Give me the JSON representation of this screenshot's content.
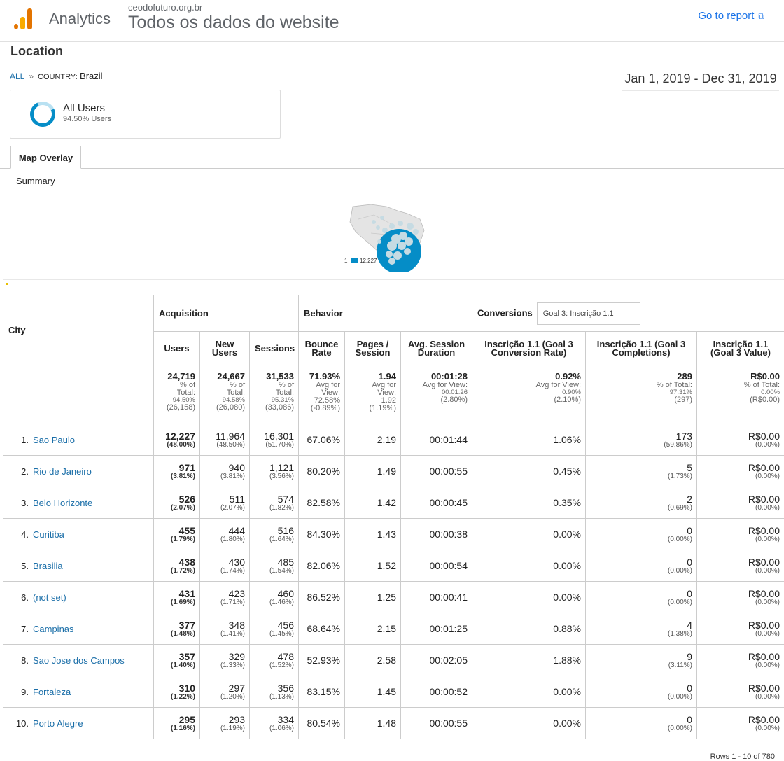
{
  "header": {
    "app_name": "Analytics",
    "account": "ceodofuturo.org.br",
    "view": "Todos os dados do website",
    "go_to_report": "Go to report"
  },
  "page": {
    "title": "Location",
    "breadcrumb_all": "ALL",
    "breadcrumb_sep": "»",
    "breadcrumb_dim": "COUNTRY:",
    "breadcrumb_value": "Brazil",
    "date_range": "Jan 1, 2019 - Dec 31, 2019"
  },
  "segment": {
    "name": "All Users",
    "pct": "94.50% Users"
  },
  "tabs": {
    "active": "Map Overlay",
    "sub": "Summary"
  },
  "map": {
    "legend_min": "1",
    "legend_max": "12,227",
    "color": "#058dc7"
  },
  "table": {
    "groups": {
      "city": "City",
      "acquisition": "Acquisition",
      "behavior": "Behavior",
      "conversions": "Conversions",
      "goal_select": "Goal 3: Inscrição 1.1"
    },
    "columns": {
      "users": "Users",
      "new_users": "New Users",
      "sessions": "Sessions",
      "bounce": "Bounce Rate",
      "pages": "Pages / Session",
      "duration": "Avg. Session Duration",
      "conv_rate": "Inscrição 1.1 (Goal 3 Conversion Rate)",
      "completions": "Inscrição 1.1 (Goal 3 Completions)",
      "value": "Inscrição 1.1 (Goal 3 Value)"
    },
    "totals": {
      "users": {
        "v": "24,719",
        "l1": "% of",
        "l2": "Total:",
        "l3": "94.50%",
        "l4": "(26,158)"
      },
      "new_users": {
        "v": "24,667",
        "l1": "% of",
        "l2": "Total:",
        "l3": "94.58%",
        "l4": "(26,080)"
      },
      "sessions": {
        "v": "31,533",
        "l1": "% of",
        "l2": "Total:",
        "l3": "95.31%",
        "l4": "(33,086)"
      },
      "bounce": {
        "v": "71.93%",
        "l1": "Avg for",
        "l2": "View:",
        "l3": "72.58%",
        "l4": "(-0.89%)"
      },
      "pages": {
        "v": "1.94",
        "l1": "Avg for",
        "l2": "View:",
        "l3": "1.92",
        "l4": "(1.19%)"
      },
      "duration": {
        "v": "00:01:28",
        "l1": "Avg for View:",
        "l2": "00:01:26",
        "l3": "(2.80%)"
      },
      "conv_rate": {
        "v": "0.92%",
        "l1": "Avg for View:",
        "l2": "0.90%",
        "l3": "(2.10%)"
      },
      "completions": {
        "v": "289",
        "l1": "% of Total:",
        "l2": "97.31%",
        "l3": "(297)"
      },
      "value": {
        "v": "R$0.00",
        "l1": "% of Total:",
        "l2": "0.00%",
        "l3": "(R$0.00)"
      }
    },
    "rows": [
      {
        "n": "1.",
        "city": "Sao Paulo",
        "users": "12,227",
        "users_p": "(48.00%)",
        "new": "11,964",
        "new_p": "(48.50%)",
        "sess": "16,301",
        "sess_p": "(51.70%)",
        "bounce": "67.06%",
        "pages": "2.19",
        "dur": "00:01:44",
        "rate": "1.06%",
        "comp": "173",
        "comp_p": "(59.86%)",
        "val": "R$0.00",
        "val_p": "(0.00%)"
      },
      {
        "n": "2.",
        "city": "Rio de Janeiro",
        "users": "971",
        "users_p": "(3.81%)",
        "new": "940",
        "new_p": "(3.81%)",
        "sess": "1,121",
        "sess_p": "(3.56%)",
        "bounce": "80.20%",
        "pages": "1.49",
        "dur": "00:00:55",
        "rate": "0.45%",
        "comp": "5",
        "comp_p": "(1.73%)",
        "val": "R$0.00",
        "val_p": "(0.00%)"
      },
      {
        "n": "3.",
        "city": "Belo Horizonte",
        "users": "526",
        "users_p": "(2.07%)",
        "new": "511",
        "new_p": "(2.07%)",
        "sess": "574",
        "sess_p": "(1.82%)",
        "bounce": "82.58%",
        "pages": "1.42",
        "dur": "00:00:45",
        "rate": "0.35%",
        "comp": "2",
        "comp_p": "(0.69%)",
        "val": "R$0.00",
        "val_p": "(0.00%)"
      },
      {
        "n": "4.",
        "city": "Curitiba",
        "users": "455",
        "users_p": "(1.79%)",
        "new": "444",
        "new_p": "(1.80%)",
        "sess": "516",
        "sess_p": "(1.64%)",
        "bounce": "84.30%",
        "pages": "1.43",
        "dur": "00:00:38",
        "rate": "0.00%",
        "comp": "0",
        "comp_p": "(0.00%)",
        "val": "R$0.00",
        "val_p": "(0.00%)"
      },
      {
        "n": "5.",
        "city": "Brasilia",
        "users": "438",
        "users_p": "(1.72%)",
        "new": "430",
        "new_p": "(1.74%)",
        "sess": "485",
        "sess_p": "(1.54%)",
        "bounce": "82.06%",
        "pages": "1.52",
        "dur": "00:00:54",
        "rate": "0.00%",
        "comp": "0",
        "comp_p": "(0.00%)",
        "val": "R$0.00",
        "val_p": "(0.00%)"
      },
      {
        "n": "6.",
        "city": "(not set)",
        "users": "431",
        "users_p": "(1.69%)",
        "new": "423",
        "new_p": "(1.71%)",
        "sess": "460",
        "sess_p": "(1.46%)",
        "bounce": "86.52%",
        "pages": "1.25",
        "dur": "00:00:41",
        "rate": "0.00%",
        "comp": "0",
        "comp_p": "(0.00%)",
        "val": "R$0.00",
        "val_p": "(0.00%)"
      },
      {
        "n": "7.",
        "city": "Campinas",
        "users": "377",
        "users_p": "(1.48%)",
        "new": "348",
        "new_p": "(1.41%)",
        "sess": "456",
        "sess_p": "(1.45%)",
        "bounce": "68.64%",
        "pages": "2.15",
        "dur": "00:01:25",
        "rate": "0.88%",
        "comp": "4",
        "comp_p": "(1.38%)",
        "val": "R$0.00",
        "val_p": "(0.00%)"
      },
      {
        "n": "8.",
        "city": "Sao Jose dos Campos",
        "users": "357",
        "users_p": "(1.40%)",
        "new": "329",
        "new_p": "(1.33%)",
        "sess": "478",
        "sess_p": "(1.52%)",
        "bounce": "52.93%",
        "pages": "2.58",
        "dur": "00:02:05",
        "rate": "1.88%",
        "comp": "9",
        "comp_p": "(3.11%)",
        "val": "R$0.00",
        "val_p": "(0.00%)"
      },
      {
        "n": "9.",
        "city": "Fortaleza",
        "users": "310",
        "users_p": "(1.22%)",
        "new": "297",
        "new_p": "(1.20%)",
        "sess": "356",
        "sess_p": "(1.13%)",
        "bounce": "83.15%",
        "pages": "1.45",
        "dur": "00:00:52",
        "rate": "0.00%",
        "comp": "0",
        "comp_p": "(0.00%)",
        "val": "R$0.00",
        "val_p": "(0.00%)"
      },
      {
        "n": "10.",
        "city": "Porto Alegre",
        "users": "295",
        "users_p": "(1.16%)",
        "new": "293",
        "new_p": "(1.19%)",
        "sess": "334",
        "sess_p": "(1.06%)",
        "bounce": "80.54%",
        "pages": "1.48",
        "dur": "00:00:55",
        "rate": "0.00%",
        "comp": "0",
        "comp_p": "(0.00%)",
        "val": "R$0.00",
        "val_p": "(0.00%)"
      }
    ]
  },
  "footer": {
    "rows_info": "Rows 1 - 10 of 780"
  },
  "colors": {
    "link": "#1a6ea8",
    "accent": "#1a73e8",
    "brand_orange": "#e37400",
    "brand_yellow": "#f9ab00"
  }
}
